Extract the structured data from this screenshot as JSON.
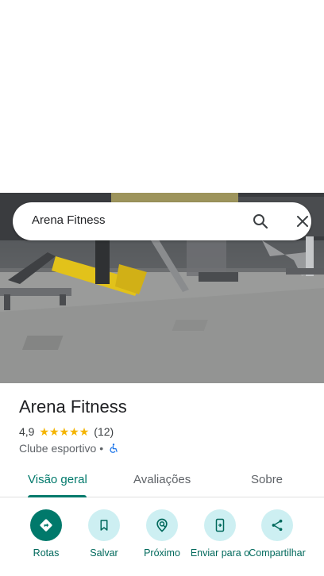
{
  "search": {
    "query": "Arena Fitness"
  },
  "place": {
    "name": "Arena Fitness",
    "rating": "4,9",
    "star_count": 5,
    "review_count": "(12)",
    "category": "Clube esportivo",
    "separator": "•"
  },
  "tabs": [
    {
      "label": "Visão geral",
      "active": true
    },
    {
      "label": "Avaliações",
      "active": false
    },
    {
      "label": "Sobre",
      "active": false
    }
  ],
  "actions": [
    {
      "label": "Rotas",
      "icon": "directions-icon"
    },
    {
      "label": "Salvar",
      "icon": "bookmark-icon"
    },
    {
      "label": "Próximo",
      "icon": "nearby-icon"
    },
    {
      "label": "Enviar para o",
      "icon": "send-to-phone-icon"
    },
    {
      "label": "Compartilhar",
      "icon": "share-icon"
    }
  ],
  "colors": {
    "accent": "#00796b",
    "action_bg": "#cdeff2",
    "star": "#f4b400"
  }
}
